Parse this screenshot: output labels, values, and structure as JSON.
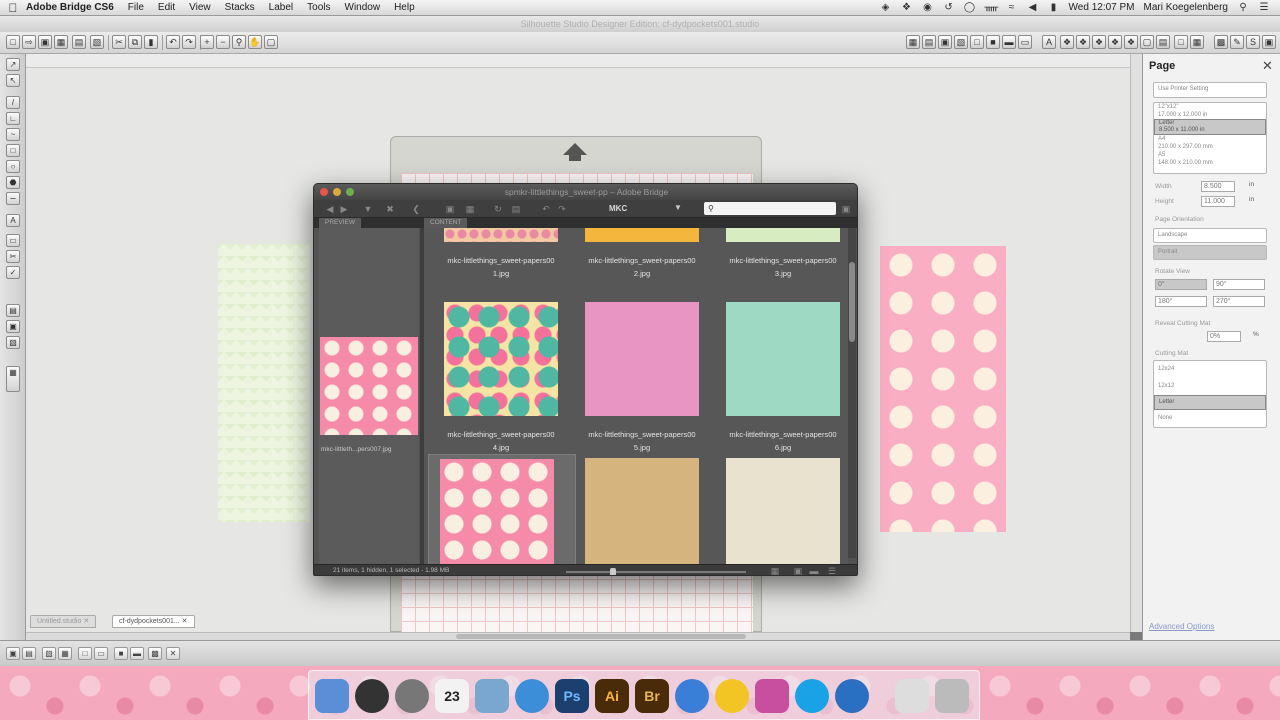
{
  "menubar": {
    "app_name": "Adobe Bridge CS6",
    "items": [
      "File",
      "Edit",
      "View",
      "Stacks",
      "Label",
      "Tools",
      "Window",
      "Help"
    ],
    "clock": "Wed 12:07 PM",
    "user": "Mari Koegelenberg"
  },
  "silhouette": {
    "window_title": "Silhouette Studio Designer Edition: cf-dydpockets001.studio",
    "tabs": [
      "Untitled.studio",
      "cf-dydpockets001..."
    ],
    "page_panel": {
      "title": "Page",
      "paper_sizes": [
        "Use Printer Setting",
        "12\"x12\"",
        "17.000 x 12.000 in",
        "Letter",
        "8.500 x 11.000 in",
        "A4",
        "210.00 x 297.00 mm",
        "A5",
        "148.00 x 210.00 mm"
      ],
      "width_label": "Width",
      "width_value": "8.500",
      "height_label": "Height",
      "height_value": "11.000",
      "unit": "in",
      "orientation_label": "Page Orientation",
      "orientation_options": [
        "Landscape",
        "Portrait"
      ],
      "rotate_label": "Rotate View",
      "rotate_options": [
        "0°",
        "90°",
        "180°",
        "270°"
      ],
      "reveal_label": "Reveal Cutting Mat",
      "reveal_value": "0%",
      "reveal_unit": "%",
      "mat_label": "Cutting Mat",
      "mat_options": [
        "12x24",
        "12x12",
        "Letter",
        "None"
      ],
      "advanced": "Advanced Options"
    }
  },
  "bridge": {
    "title": "spmkr-littlethings_sweet-pp – Adobe Bridge",
    "workspace": "MKC",
    "search_placeholder": "",
    "tabs": {
      "preview": "PREVIEW",
      "content": "CONTENT"
    },
    "preview_caption": "mkc-littleth...pers007.jpg",
    "files": [
      {
        "line1": "mkc-littlethings_sweet-papers00",
        "line2": "1.jpg",
        "color": "#f3c9a2"
      },
      {
        "line1": "mkc-littlethings_sweet-papers00",
        "line2": "2.jpg",
        "color": "#f4b63c"
      },
      {
        "line1": "mkc-littlethings_sweet-papers00",
        "line2": "3.jpg",
        "color": "#d8ecc2"
      },
      {
        "line1": "mkc-littlethings_sweet-papers00",
        "line2": "4.jpg",
        "color": "#f6e4a4"
      },
      {
        "line1": "mkc-littlethings_sweet-papers00",
        "line2": "5.jpg",
        "color": "#e995c4"
      },
      {
        "line1": "mkc-littlethings_sweet-papers00",
        "line2": "6.jpg",
        "color": "#9ed9c4"
      },
      {
        "line1": "",
        "line2": "",
        "color": "#f58aa9"
      },
      {
        "line1": "",
        "line2": "",
        "color": "#d6b47e"
      },
      {
        "line1": "",
        "line2": "",
        "color": "#e9e2cf"
      }
    ],
    "status": "21 items, 1 hidden, 1 selected - 1.98 MB"
  },
  "dock": {
    "icons": [
      {
        "name": "finder",
        "label": "",
        "color": "#5a8fd8"
      },
      {
        "name": "dvd-player",
        "label": "",
        "color": "#333333"
      },
      {
        "name": "launchpad",
        "label": "",
        "color": "#777777"
      },
      {
        "name": "calendar",
        "label": "23",
        "color": "#f2f2f2"
      },
      {
        "name": "preview",
        "label": "",
        "color": "#7aa7cf"
      },
      {
        "name": "safari",
        "label": "",
        "color": "#3d8ed8"
      },
      {
        "name": "photoshop",
        "label": "Ps",
        "color": "#1b3f6e"
      },
      {
        "name": "illustrator",
        "label": "Ai",
        "color": "#4a2b08"
      },
      {
        "name": "bridge",
        "label": "Br",
        "color": "#4a2b08"
      },
      {
        "name": "itunes",
        "label": "",
        "color": "#3a7ed8"
      },
      {
        "name": "adium",
        "label": "",
        "color": "#f2c524"
      },
      {
        "name": "photo-booth",
        "label": "",
        "color": "#c84ea0"
      },
      {
        "name": "skype",
        "label": "",
        "color": "#19a3e6"
      },
      {
        "name": "network",
        "label": "",
        "color": "#2b6fc2"
      },
      {
        "name": "documents",
        "label": "",
        "color": "#dddddd"
      },
      {
        "name": "trash",
        "label": "",
        "color": "#bbbbbb"
      }
    ]
  }
}
